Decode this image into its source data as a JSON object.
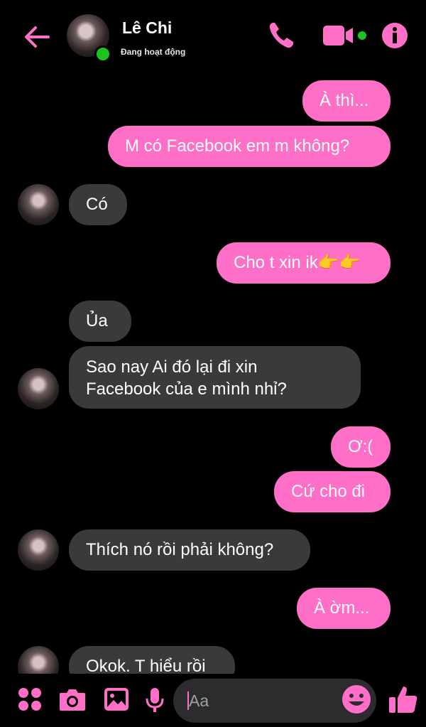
{
  "header": {
    "contact_name": "Lê Chi",
    "status": "Đang hoạt động",
    "accent_color": "#ff6ec7",
    "online_color": "#1ec31e",
    "icons": [
      "back-arrow-icon",
      "phone-icon",
      "video-icon",
      "info-icon"
    ]
  },
  "messages": [
    {
      "from": "me",
      "text": "À thì..."
    },
    {
      "from": "me",
      "text": "M có Facebook em m không?"
    },
    {
      "from": "them",
      "text": "Có"
    },
    {
      "from": "me",
      "text": "Cho t xin ik👉👉"
    },
    {
      "from": "them",
      "text": "Ủa"
    },
    {
      "from": "them",
      "text": "Sao nay Ai đó lại đi xin"
    },
    {
      "from": "them",
      "text": "Facebook của e mình nhỉ?"
    },
    {
      "from": "me",
      "text": "Ơ:("
    },
    {
      "from": "me",
      "text": "Cứ cho đi"
    },
    {
      "from": "them",
      "text": "Thích nó rồi phải không?"
    },
    {
      "from": "me",
      "text": "À ờm..."
    },
    {
      "from": "them",
      "text": "Okok. T hiểu rồi"
    }
  ],
  "composer": {
    "placeholder": "Aa",
    "icons": [
      "apps-icon",
      "camera-icon",
      "image-icon",
      "microphone-icon",
      "emoji-icon",
      "thumbs-up-icon"
    ]
  }
}
